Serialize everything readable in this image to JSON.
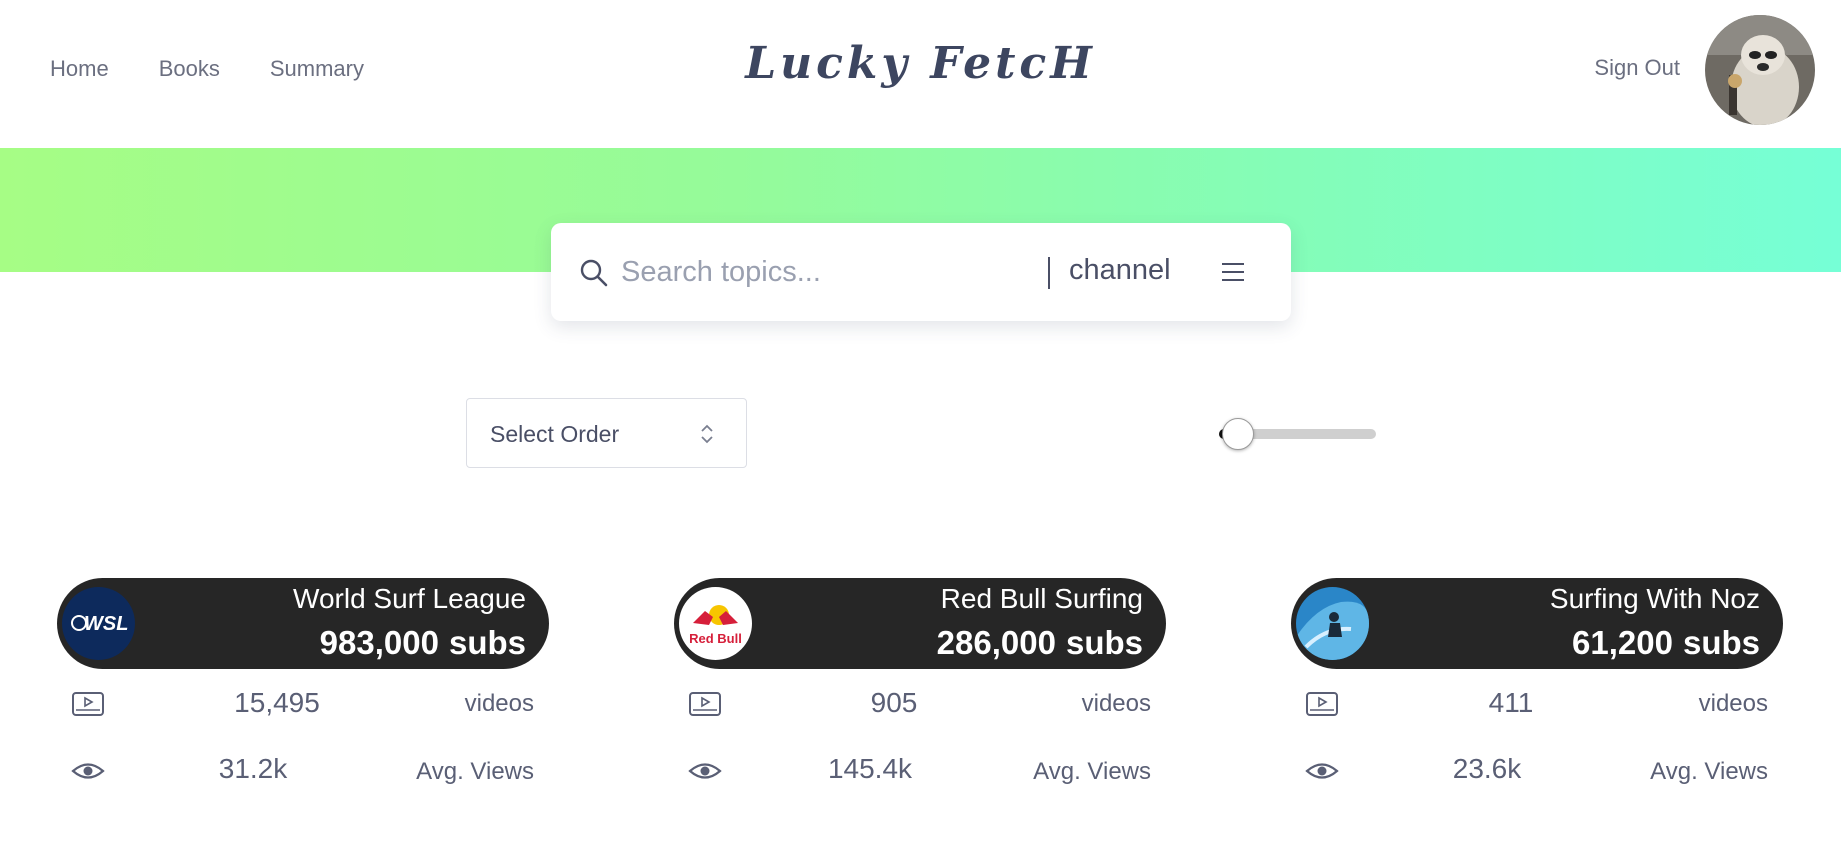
{
  "nav": {
    "home": "Home",
    "books": "Books",
    "summary": "Summary"
  },
  "brand": {
    "title": "Lucky FetcH"
  },
  "account": {
    "sign_out": "Sign Out"
  },
  "banner": {
    "gradient_start": "#a6fd85",
    "gradient_end": "#76ffd6"
  },
  "search": {
    "placeholder": "Search topics...",
    "value": "",
    "filter": "channel",
    "menu_icon": "hamburger-icon"
  },
  "order": {
    "label": "Select Order"
  },
  "slider": {
    "value_fraction": 0.02
  },
  "cards": [
    {
      "name": "World Surf League",
      "subs": "983,000",
      "subs_unit": "subs",
      "logo": {
        "text": "WSL",
        "bg": "#0d2a5c"
      },
      "videos": "15,495",
      "videos_label": "videos",
      "avg_views": "31.2k",
      "avg_views_label": "Avg. Views"
    },
    {
      "name": "Red Bull Surfing",
      "subs": "286,000",
      "subs_unit": "subs",
      "logo": {
        "text": "Red Bull",
        "bg": "#ffffff"
      },
      "videos": "905",
      "videos_label": "videos",
      "avg_views": "145.4k",
      "avg_views_label": "Avg. Views"
    },
    {
      "name": "Surfing With Noz",
      "subs": "61,200",
      "subs_unit": "subs",
      "logo": {
        "text": "",
        "bg": "#2a86c8"
      },
      "videos": "411",
      "videos_label": "videos",
      "avg_views": "23.6k",
      "avg_views_label": "Avg. Views"
    }
  ]
}
